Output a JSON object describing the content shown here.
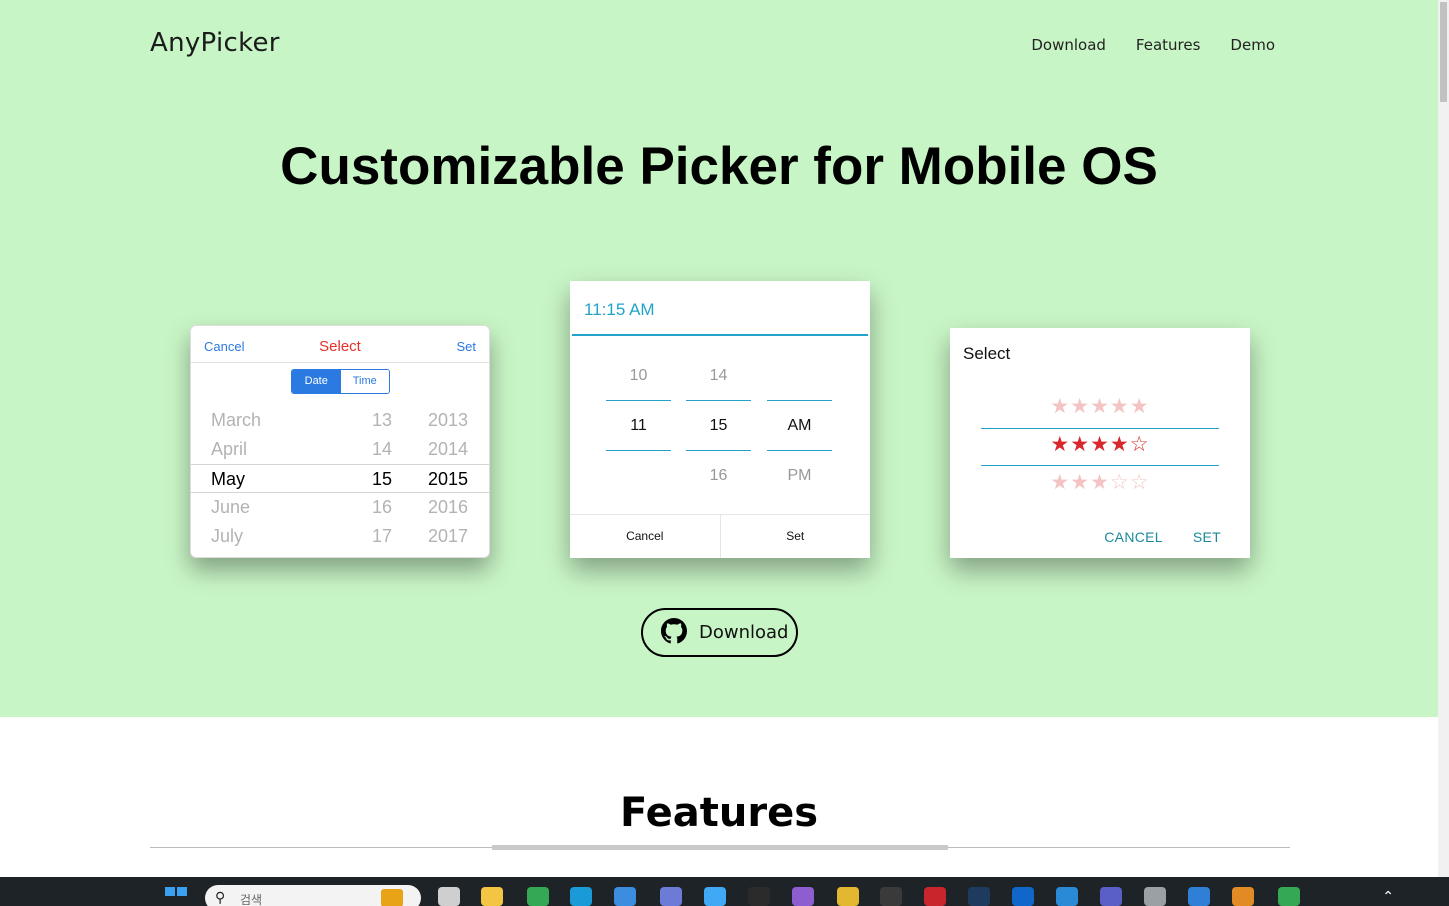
{
  "nav": {
    "brand": "AnyPicker",
    "links": [
      "Download",
      "Features",
      "Demo"
    ]
  },
  "hero": {
    "headline": "Customizable Picker for Mobile OS"
  },
  "ios_picker": {
    "cancel": "Cancel",
    "title": "Select",
    "set": "Set",
    "segments": [
      "Date",
      "Time"
    ],
    "rows": [
      [
        "March",
        "13",
        "2013"
      ],
      [
        "April",
        "14",
        "2014"
      ],
      [
        "May",
        "15",
        "2015"
      ],
      [
        "June",
        "16",
        "2016"
      ],
      [
        "July",
        "17",
        "2017"
      ]
    ]
  },
  "android_picker": {
    "time": "11:15 AM",
    "col1": [
      "10",
      "11"
    ],
    "col2": [
      "14",
      "15",
      "16"
    ],
    "col3": [
      "AM",
      "PM"
    ],
    "cancel": "Cancel",
    "set": "Set"
  },
  "rating_picker": {
    "title": "Select",
    "rows": [
      "★★★★★",
      "★★★★☆",
      "★★★☆☆"
    ],
    "cancel": "CANCEL",
    "set": "SET"
  },
  "download_button": {
    "label": "Download",
    "icon": "github-icon"
  },
  "features": {
    "title": "Features"
  },
  "taskbar": {
    "search_placeholder": "검색"
  },
  "colors": {
    "hero_bg": "#c8f5c6",
    "ios_blue": "#2a7ae2",
    "ios_red": "#e5312a",
    "android_teal": "#23a3c9",
    "star_red": "#d8272d"
  }
}
